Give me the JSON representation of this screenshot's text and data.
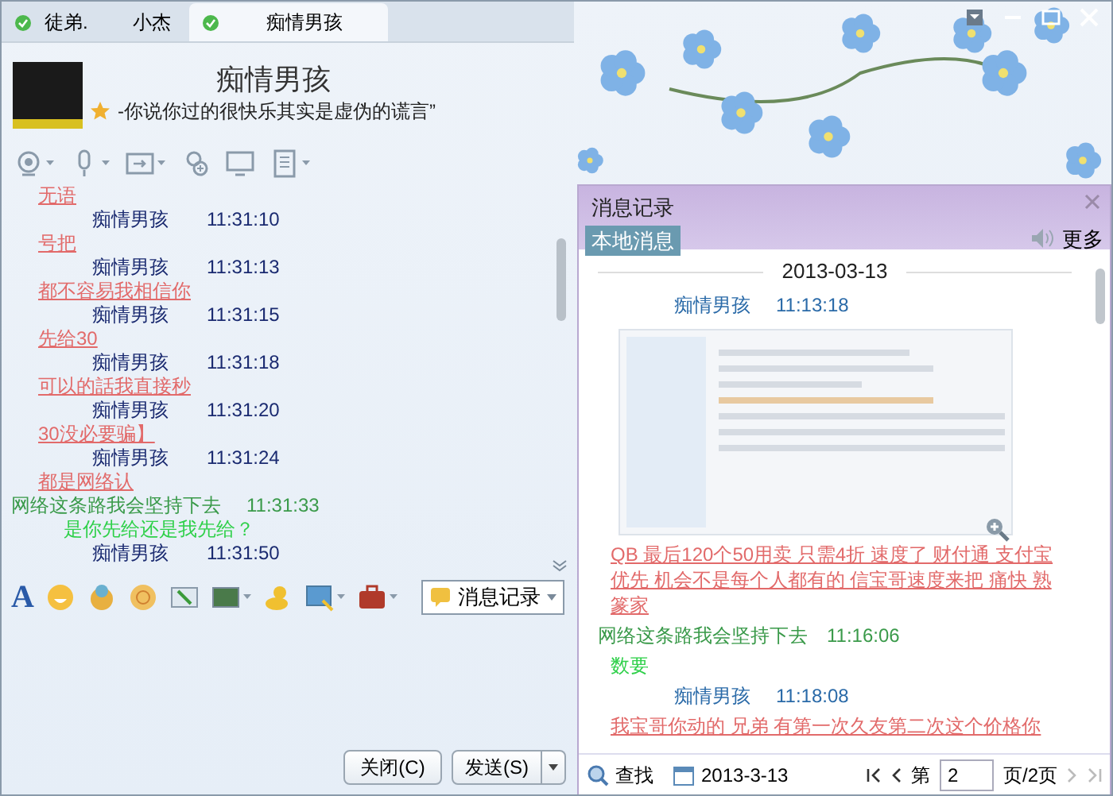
{
  "tabs": [
    {
      "label": "徒弟.",
      "online": true,
      "selected": false
    },
    {
      "label": "小杰",
      "online": false,
      "selected": false
    },
    {
      "label": "痴情男孩",
      "online": true,
      "selected": true
    }
  ],
  "contact": {
    "name": "痴情男孩",
    "signature": "-你说你过的很快乐其实是虚伪的谎言”"
  },
  "chat": {
    "messages": [
      {
        "kind": "text",
        "own": false,
        "text": "无语"
      },
      {
        "kind": "meta",
        "own": false,
        "name": "痴情男孩",
        "time": "11:31:10"
      },
      {
        "kind": "text",
        "own": false,
        "text": "号把"
      },
      {
        "kind": "meta",
        "own": false,
        "name": "痴情男孩",
        "time": "11:31:13"
      },
      {
        "kind": "text",
        "own": false,
        "text": "都不容易我相信你"
      },
      {
        "kind": "meta",
        "own": false,
        "name": "痴情男孩",
        "time": "11:31:15"
      },
      {
        "kind": "text",
        "own": false,
        "text": "先给30"
      },
      {
        "kind": "meta",
        "own": false,
        "name": "痴情男孩",
        "time": "11:31:18"
      },
      {
        "kind": "text",
        "own": false,
        "text": "可以的話我直接秒"
      },
      {
        "kind": "meta",
        "own": false,
        "name": "痴情男孩",
        "time": "11:31:20"
      },
      {
        "kind": "text",
        "own": false,
        "text": "30没必要骗】"
      },
      {
        "kind": "meta",
        "own": false,
        "name": "痴情男孩",
        "time": "11:31:24"
      },
      {
        "kind": "text",
        "own": false,
        "text": "都是网络认"
      },
      {
        "kind": "meta",
        "own": true,
        "name": "网络这条路我会坚持下去",
        "time": "11:31:33"
      },
      {
        "kind": "text",
        "own": true,
        "text": "是你先给还是我先给？"
      },
      {
        "kind": "meta",
        "own": false,
        "name": "痴情男孩",
        "time": "11:31:50"
      }
    ]
  },
  "format_bar": {
    "font_button": "A"
  },
  "message_history_button": {
    "label": "消息记录"
  },
  "buttons": [
    {
      "label": "关闭(C)",
      "kind": "plain"
    },
    {
      "label": "发送(S)",
      "kind": "split"
    }
  ],
  "history": {
    "title": "消息记录",
    "tabs": [
      {
        "label": "本地消息",
        "selected": true
      }
    ],
    "more": "更多",
    "date": "2013-03-13",
    "messages": [
      {
        "kind": "meta",
        "own": false,
        "name": "痴情男孩",
        "time": "11:13:18"
      },
      {
        "kind": "image"
      },
      {
        "kind": "text",
        "own": false,
        "text": "QB 最后120个50用卖 只需4折 速度了 财付通 支付宝优先 机会不是每个人都有的 信宝哥速度来把 痛快 熟篆家"
      },
      {
        "kind": "meta",
        "own": true,
        "name": "网络这条路我会坚持下去",
        "time": "11:16:06"
      },
      {
        "kind": "text",
        "own": true,
        "text": "数要"
      },
      {
        "kind": "meta",
        "own": false,
        "name": "痴情男孩",
        "time": "11:18:08"
      },
      {
        "kind": "text",
        "own": false,
        "text": "我宝哥你动的 兄弟 有第一次久友第二次这个价格你"
      }
    ],
    "find": "查找",
    "find_date": "2013-3-13",
    "page_prefix": "第",
    "page": "2",
    "page_suffix": "页/2页"
  }
}
